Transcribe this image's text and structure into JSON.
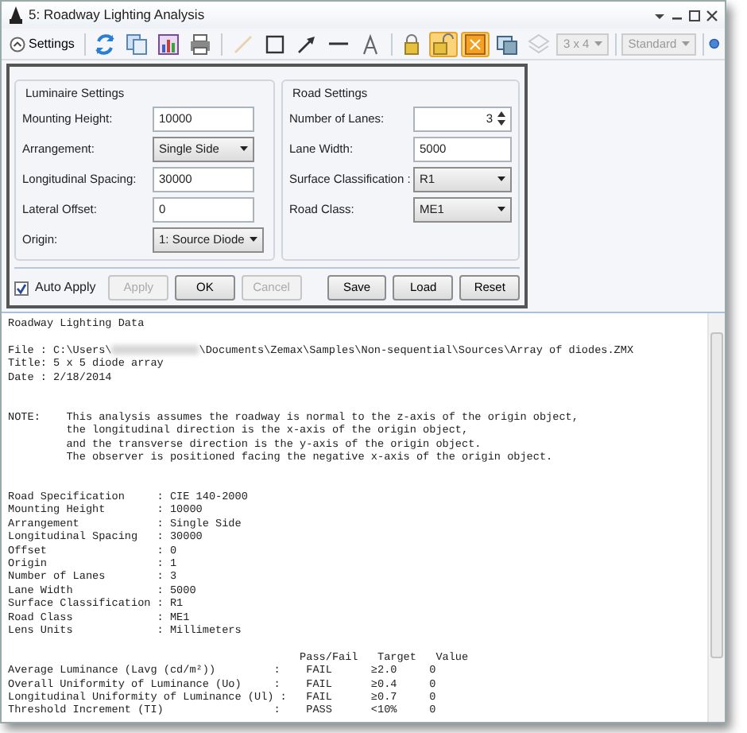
{
  "window": {
    "title": "5: Roadway Lighting Analysis"
  },
  "toolbar": {
    "settings": "Settings",
    "settings_expanded": true,
    "tools": [
      {
        "selected": false,
        "disabled": false
      },
      {
        "selected": false,
        "disabled": false
      },
      {
        "selected": false,
        "disabled": false
      },
      {
        "selected": false,
        "disabled": false
      },
      {
        "selected": false,
        "disabled": true
      },
      {
        "selected": false,
        "disabled": false
      },
      {
        "selected": false,
        "disabled": false
      },
      {
        "selected": false,
        "disabled": false
      },
      {
        "selected": false,
        "disabled": false
      },
      {
        "selected": false,
        "disabled": false
      },
      {
        "selected": true,
        "disabled": false
      },
      {
        "selected": true,
        "disabled": false
      },
      {
        "selected": false,
        "disabled": false
      },
      {
        "selected": false,
        "disabled": true
      }
    ],
    "dropdowns": [
      {
        "value": "3 x 4",
        "disabled": true
      },
      {
        "value": "Standard",
        "disabled": true
      }
    ]
  },
  "luminaire_settings": {
    "title": "Luminaire Settings",
    "fields": [
      {
        "label": "Mounting Height:",
        "kind": "text",
        "value": "10000"
      },
      {
        "label": "Arrangement:",
        "kind": "select",
        "value": "Single Side"
      },
      {
        "label": "Longitudinal Spacing:",
        "kind": "text",
        "value": "30000"
      },
      {
        "label": "Lateral Offset:",
        "kind": "text",
        "value": "0"
      },
      {
        "label": "Origin:",
        "kind": "select",
        "value": "1: Source Diode"
      }
    ]
  },
  "road_settings": {
    "title": "Road Settings",
    "fields": [
      {
        "label": "Number of Lanes:",
        "kind": "spin",
        "value": "3"
      },
      {
        "label": "Lane Width:",
        "kind": "text",
        "value": "5000"
      },
      {
        "label": "Surface Classification :",
        "kind": "select",
        "value": "R1"
      },
      {
        "label": "Road Class:",
        "kind": "select",
        "value": "ME1"
      }
    ]
  },
  "auto_apply": {
    "label": "Auto Apply",
    "checked": true
  },
  "buttons": [
    {
      "label": "Apply",
      "disabled": true
    },
    {
      "label": "OK",
      "disabled": false
    },
    {
      "label": "Cancel",
      "disabled": true
    },
    {
      "label": "Save",
      "disabled": false
    },
    {
      "label": "Load",
      "disabled": false
    },
    {
      "label": "Reset",
      "disabled": false
    }
  ],
  "report": {
    "lines": [
      {
        "kind": "text",
        "text": "Roadway Lighting Data"
      },
      {
        "kind": "blank"
      },
      {
        "kind": "redacted",
        "before": "File : C:\\Users\\",
        "after": "\\Documents\\Zemax\\Samples\\Non-sequential\\Sources\\Array of diodes.ZMX"
      },
      {
        "kind": "text",
        "text": "Title: 5 x 5 diode array"
      },
      {
        "kind": "text",
        "text": "Date : 2/18/2014"
      },
      {
        "kind": "blank"
      },
      {
        "kind": "blank"
      },
      {
        "kind": "text",
        "text": "NOTE:    This analysis assumes the roadway is normal to the z-axis of the origin object,"
      },
      {
        "kind": "text",
        "text": "         the longitudinal direction is the x-axis of the origin object,"
      },
      {
        "kind": "text",
        "text": "         and the transverse direction is the y-axis of the origin object."
      },
      {
        "kind": "text",
        "text": "         The observer is positioned facing the negative x-axis of the origin object."
      },
      {
        "kind": "blank"
      },
      {
        "kind": "blank"
      },
      {
        "kind": "text",
        "text": "Road Specification     : CIE 140-2000"
      },
      {
        "kind": "text",
        "text": "Mounting Height        : 10000"
      },
      {
        "kind": "text",
        "text": "Arrangement            : Single Side"
      },
      {
        "kind": "text",
        "text": "Longitudinal Spacing   : 30000"
      },
      {
        "kind": "text",
        "text": "Offset                 : 0"
      },
      {
        "kind": "text",
        "text": "Origin                 : 1"
      },
      {
        "kind": "text",
        "text": "Number of Lanes        : 3"
      },
      {
        "kind": "text",
        "text": "Lane Width             : 5000"
      },
      {
        "kind": "text",
        "text": "Surface Classification : R1"
      },
      {
        "kind": "text",
        "text": "Road Class             : ME1"
      },
      {
        "kind": "text",
        "text": "Lens Units             : Millimeters"
      },
      {
        "kind": "blank"
      },
      {
        "kind": "text",
        "text": "                                             Pass/Fail   Target   Value"
      },
      {
        "kind": "text",
        "text": "Average Luminance (Lavg (cd/m²))         :    FAIL      ≥2.0     0"
      },
      {
        "kind": "text",
        "text": "Overall Uniformity of Luminance (Uo)     :    FAIL      ≥0.4     0"
      },
      {
        "kind": "text",
        "text": "Longitudinal Uniformity of Luminance (Ul) :   FAIL      ≥0.7     0"
      },
      {
        "kind": "text",
        "text": "Threshold Increment (TI)                 :    PASS      <10%     0"
      }
    ]
  }
}
